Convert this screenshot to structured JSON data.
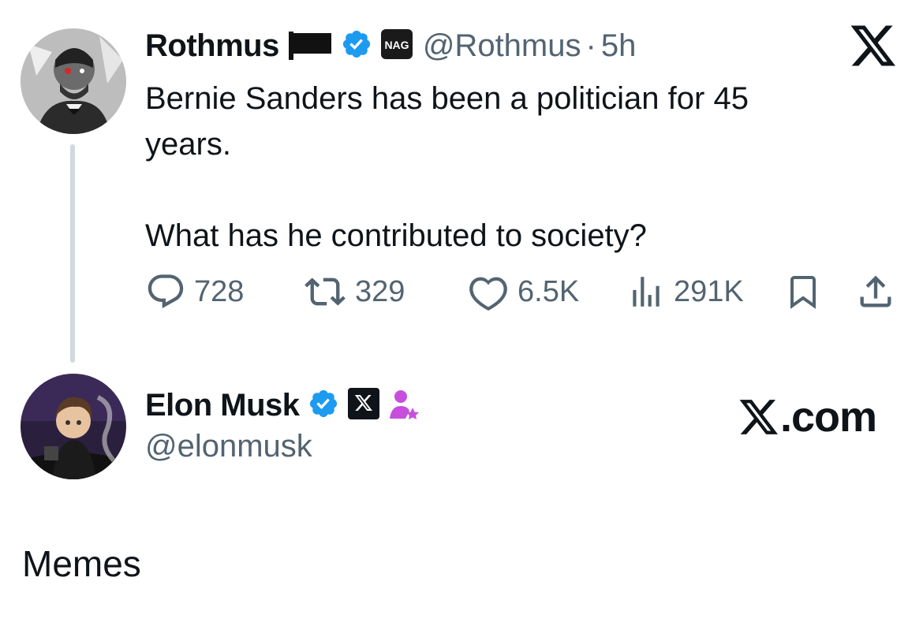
{
  "tweet1": {
    "name": "Rothmus",
    "handle": "@Rothmus",
    "separator": "·",
    "time": "5h",
    "badge_text": "NAG",
    "text": "Bernie Sanders has been a politician for 45\nyears.\n\nWhat has he contributed to society?",
    "stats": {
      "replies": "728",
      "reposts": "329",
      "likes": "6.5K",
      "views": "291K"
    }
  },
  "tweet2": {
    "name": "Elon Musk",
    "handle": "@elonmusk",
    "badge_logo": "𝕏",
    "site": ".com",
    "site_logo": "𝕏"
  },
  "caption": "Memes",
  "icons": {
    "verified": "verified-badge-icon",
    "flag": "black-flag-icon",
    "x_logo": "x-logo-icon",
    "reply": "reply-icon",
    "repost": "repost-icon",
    "like": "heart-icon",
    "views": "views-icon",
    "bookmark": "bookmark-icon",
    "share": "share-icon",
    "person_star": "person-star-icon"
  },
  "colors": {
    "text": "#0f1419",
    "secondary": "#536471",
    "verified": "#1d9bf0",
    "thread_line": "#cfd9de",
    "purple": "#c64fdc"
  }
}
